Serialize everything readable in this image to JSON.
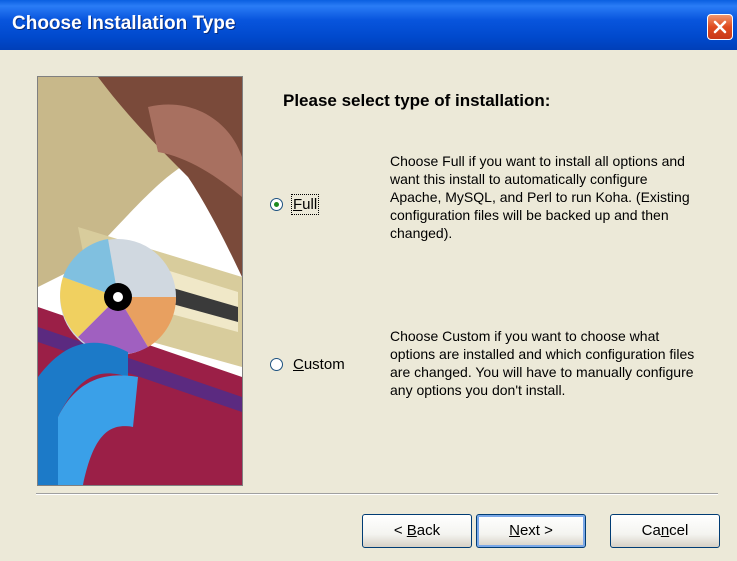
{
  "window": {
    "title": "Choose Installation Type"
  },
  "heading": "Please select type of installation:",
  "options": [
    {
      "label": "Full",
      "mnemonic": "F",
      "rest": "ull",
      "checked": true,
      "description": "Choose Full if you want to install all options and want this install to automatically configure Apache, MySQL, and Perl to run Koha. (Existing configuration files will be backed up and then changed)."
    },
    {
      "label": "Custom",
      "mnemonic": "C",
      "rest": "ustom",
      "checked": false,
      "description": "Choose Custom if you want to choose what options are installed and which configuration files are changed. You will have to manually configure any options you don't install."
    }
  ],
  "buttons": {
    "back": {
      "label": "< Back",
      "pre": "< ",
      "mnemonic": "B",
      "rest": "ack"
    },
    "next": {
      "label": "Next >",
      "mnemonic": "N",
      "rest": "ext >"
    },
    "cancel": {
      "label": "Cancel",
      "pre": "Ca",
      "mnemonic": "n",
      "rest": "cel"
    }
  },
  "icons": {
    "close": "close-icon",
    "banner": "cd-drive-illustration"
  },
  "colors": {
    "titlebar": "#0855dd",
    "dialog": "#ece9d8",
    "close": "#df4b1f"
  }
}
